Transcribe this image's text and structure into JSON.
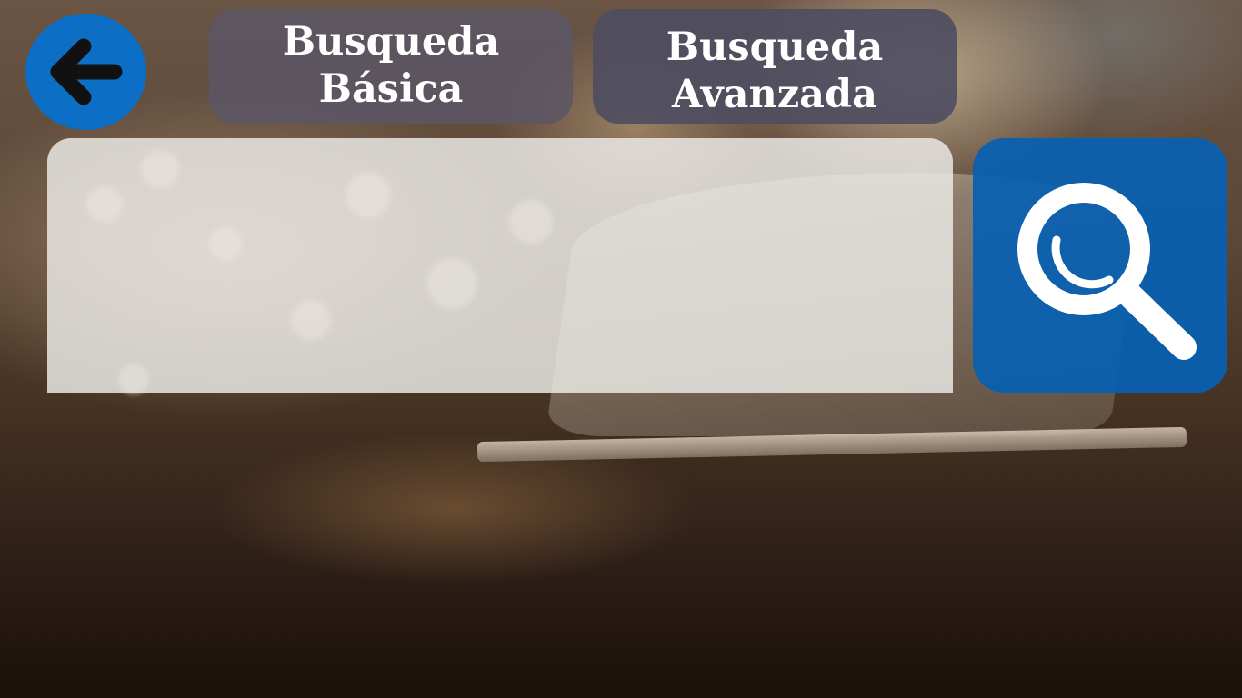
{
  "header": {
    "tabs": [
      {
        "label_line1": "Busqueda",
        "label_line2": "Básica"
      },
      {
        "label_line1": "Busqueda",
        "label_line2": "Avanzada"
      }
    ]
  },
  "search": {
    "value": "",
    "placeholder": ""
  },
  "icons": {
    "back": "arrow-left-icon",
    "search": "magnifier-icon"
  },
  "colors": {
    "accent_blue": "#0d6ec6",
    "tab_background": "#5a5666",
    "tab_text": "#ffffff",
    "input_background": "#ebe9e6"
  }
}
